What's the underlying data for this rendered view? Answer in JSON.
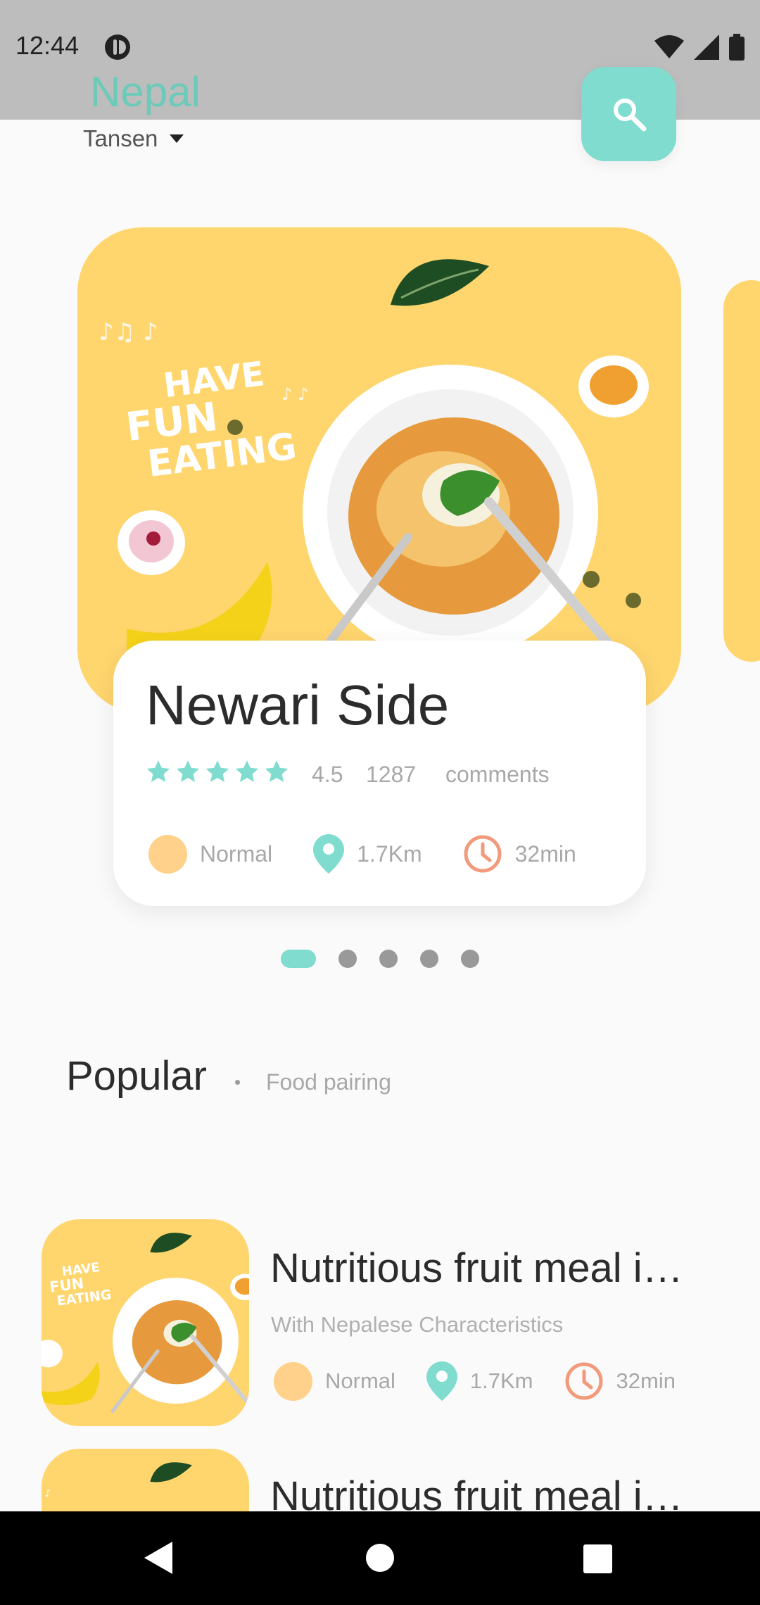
{
  "status_bar": {
    "time": "12:44"
  },
  "header": {
    "title": "Nepal",
    "location": "Tansen"
  },
  "icons": {
    "search": "search-icon",
    "location_caret": "caret-down-icon",
    "star": "star-icon",
    "pin": "location-pin-icon",
    "clock": "clock-icon",
    "back": "back-icon",
    "home": "home-icon",
    "recents": "recents-icon"
  },
  "colors": {
    "accent": "#7fdccf",
    "title_teal": "#6ccab8",
    "food_bg": "#ffd56e",
    "difficulty_dot": "#ffd18a",
    "clock": "#f19a7c"
  },
  "featured": {
    "image_text": [
      "HAVE",
      "FUN",
      "EATING"
    ],
    "title": "Newari Side",
    "rating": "4.5",
    "stars": 5,
    "comment_count": "1287",
    "comment_label": "comments",
    "difficulty": "Normal",
    "distance": "1.7Km",
    "time": "32min"
  },
  "pager": {
    "count": 5,
    "active": 0
  },
  "popular": {
    "title": "Popular",
    "subtitle": "Food pairing",
    "items": [
      {
        "title": "Nutritious fruit meal i…",
        "subtitle": "With Nepalese Characteristics",
        "difficulty": "Normal",
        "distance": "1.7Km",
        "time": "32min"
      },
      {
        "title": "Nutritious fruit meal i…"
      }
    ]
  }
}
